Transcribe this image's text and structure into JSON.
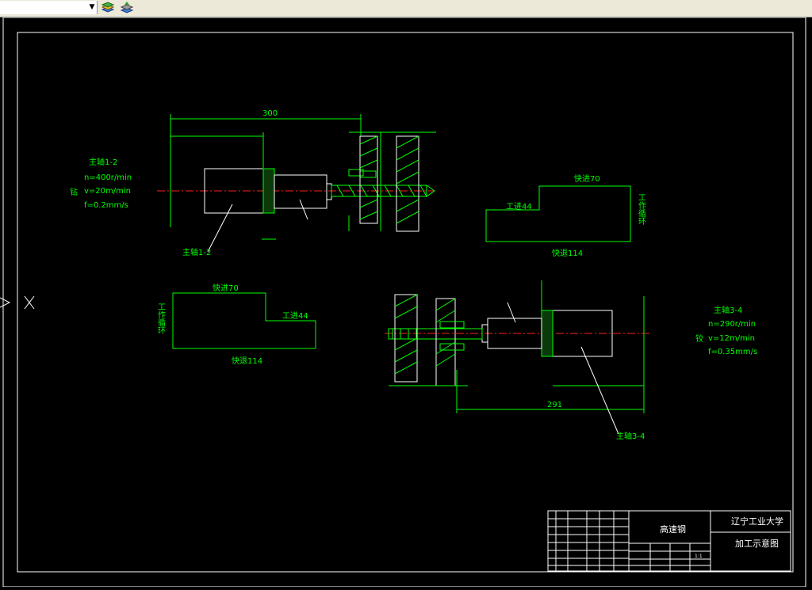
{
  "toolbar": {
    "dropdown_value": "",
    "arrow": "▼",
    "icons": [
      "layer-stack-icon",
      "layer-properties-icon"
    ]
  },
  "drawing": {
    "upper": {
      "spindle_label": "主轴1-2",
      "spec_title": "主轴1-2",
      "spec_n": "n=400r/min",
      "spec_v": "v=20m/min",
      "spec_f": "f=0.2mm/s",
      "op_vertical": "钻",
      "dim_top": "300",
      "cycle_title": "快进70",
      "cycle_work": "工进44",
      "cycle_return": "快退114",
      "cycle_side": "工作循环"
    },
    "lower": {
      "spindle_label": "主轴3-4",
      "spec_title": "主轴3-4",
      "spec_n": "n=290r/min",
      "spec_v": "v=12m/min",
      "spec_f": "f=0.35mm/s",
      "op_vertical": "铰",
      "dim_bottom": "291",
      "cycle_title": "快进70",
      "cycle_work": "工进44",
      "cycle_return": "快退114",
      "cycle_side": "工作循环"
    },
    "title_block": {
      "material": "高速钢",
      "school": "辽宁工业大学",
      "drawing_name": "加工示意图",
      "scale": "1:1"
    },
    "colors": {
      "background": "#000000",
      "frame": "#ffffff",
      "lines": "#00ff00",
      "centerline": "#ff2020",
      "labels": "#00ff00"
    }
  }
}
